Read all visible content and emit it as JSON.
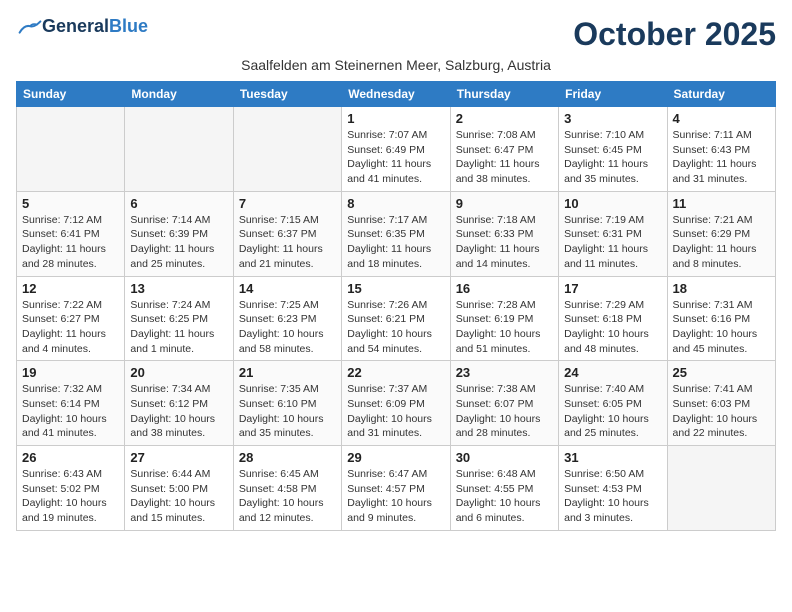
{
  "header": {
    "logo_general": "General",
    "logo_blue": "Blue",
    "month_title": "October 2025",
    "subtitle": "Saalfelden am Steinernen Meer, Salzburg, Austria"
  },
  "days_of_week": [
    "Sunday",
    "Monday",
    "Tuesday",
    "Wednesday",
    "Thursday",
    "Friday",
    "Saturday"
  ],
  "weeks": [
    [
      {
        "day": "",
        "info": ""
      },
      {
        "day": "",
        "info": ""
      },
      {
        "day": "",
        "info": ""
      },
      {
        "day": "1",
        "info": "Sunrise: 7:07 AM\nSunset: 6:49 PM\nDaylight: 11 hours and 41 minutes."
      },
      {
        "day": "2",
        "info": "Sunrise: 7:08 AM\nSunset: 6:47 PM\nDaylight: 11 hours and 38 minutes."
      },
      {
        "day": "3",
        "info": "Sunrise: 7:10 AM\nSunset: 6:45 PM\nDaylight: 11 hours and 35 minutes."
      },
      {
        "day": "4",
        "info": "Sunrise: 7:11 AM\nSunset: 6:43 PM\nDaylight: 11 hours and 31 minutes."
      }
    ],
    [
      {
        "day": "5",
        "info": "Sunrise: 7:12 AM\nSunset: 6:41 PM\nDaylight: 11 hours and 28 minutes."
      },
      {
        "day": "6",
        "info": "Sunrise: 7:14 AM\nSunset: 6:39 PM\nDaylight: 11 hours and 25 minutes."
      },
      {
        "day": "7",
        "info": "Sunrise: 7:15 AM\nSunset: 6:37 PM\nDaylight: 11 hours and 21 minutes."
      },
      {
        "day": "8",
        "info": "Sunrise: 7:17 AM\nSunset: 6:35 PM\nDaylight: 11 hours and 18 minutes."
      },
      {
        "day": "9",
        "info": "Sunrise: 7:18 AM\nSunset: 6:33 PM\nDaylight: 11 hours and 14 minutes."
      },
      {
        "day": "10",
        "info": "Sunrise: 7:19 AM\nSunset: 6:31 PM\nDaylight: 11 hours and 11 minutes."
      },
      {
        "day": "11",
        "info": "Sunrise: 7:21 AM\nSunset: 6:29 PM\nDaylight: 11 hours and 8 minutes."
      }
    ],
    [
      {
        "day": "12",
        "info": "Sunrise: 7:22 AM\nSunset: 6:27 PM\nDaylight: 11 hours and 4 minutes."
      },
      {
        "day": "13",
        "info": "Sunrise: 7:24 AM\nSunset: 6:25 PM\nDaylight: 11 hours and 1 minute."
      },
      {
        "day": "14",
        "info": "Sunrise: 7:25 AM\nSunset: 6:23 PM\nDaylight: 10 hours and 58 minutes."
      },
      {
        "day": "15",
        "info": "Sunrise: 7:26 AM\nSunset: 6:21 PM\nDaylight: 10 hours and 54 minutes."
      },
      {
        "day": "16",
        "info": "Sunrise: 7:28 AM\nSunset: 6:19 PM\nDaylight: 10 hours and 51 minutes."
      },
      {
        "day": "17",
        "info": "Sunrise: 7:29 AM\nSunset: 6:18 PM\nDaylight: 10 hours and 48 minutes."
      },
      {
        "day": "18",
        "info": "Sunrise: 7:31 AM\nSunset: 6:16 PM\nDaylight: 10 hours and 45 minutes."
      }
    ],
    [
      {
        "day": "19",
        "info": "Sunrise: 7:32 AM\nSunset: 6:14 PM\nDaylight: 10 hours and 41 minutes."
      },
      {
        "day": "20",
        "info": "Sunrise: 7:34 AM\nSunset: 6:12 PM\nDaylight: 10 hours and 38 minutes."
      },
      {
        "day": "21",
        "info": "Sunrise: 7:35 AM\nSunset: 6:10 PM\nDaylight: 10 hours and 35 minutes."
      },
      {
        "day": "22",
        "info": "Sunrise: 7:37 AM\nSunset: 6:09 PM\nDaylight: 10 hours and 31 minutes."
      },
      {
        "day": "23",
        "info": "Sunrise: 7:38 AM\nSunset: 6:07 PM\nDaylight: 10 hours and 28 minutes."
      },
      {
        "day": "24",
        "info": "Sunrise: 7:40 AM\nSunset: 6:05 PM\nDaylight: 10 hours and 25 minutes."
      },
      {
        "day": "25",
        "info": "Sunrise: 7:41 AM\nSunset: 6:03 PM\nDaylight: 10 hours and 22 minutes."
      }
    ],
    [
      {
        "day": "26",
        "info": "Sunrise: 6:43 AM\nSunset: 5:02 PM\nDaylight: 10 hours and 19 minutes."
      },
      {
        "day": "27",
        "info": "Sunrise: 6:44 AM\nSunset: 5:00 PM\nDaylight: 10 hours and 15 minutes."
      },
      {
        "day": "28",
        "info": "Sunrise: 6:45 AM\nSunset: 4:58 PM\nDaylight: 10 hours and 12 minutes."
      },
      {
        "day": "29",
        "info": "Sunrise: 6:47 AM\nSunset: 4:57 PM\nDaylight: 10 hours and 9 minutes."
      },
      {
        "day": "30",
        "info": "Sunrise: 6:48 AM\nSunset: 4:55 PM\nDaylight: 10 hours and 6 minutes."
      },
      {
        "day": "31",
        "info": "Sunrise: 6:50 AM\nSunset: 4:53 PM\nDaylight: 10 hours and 3 minutes."
      },
      {
        "day": "",
        "info": ""
      }
    ]
  ]
}
